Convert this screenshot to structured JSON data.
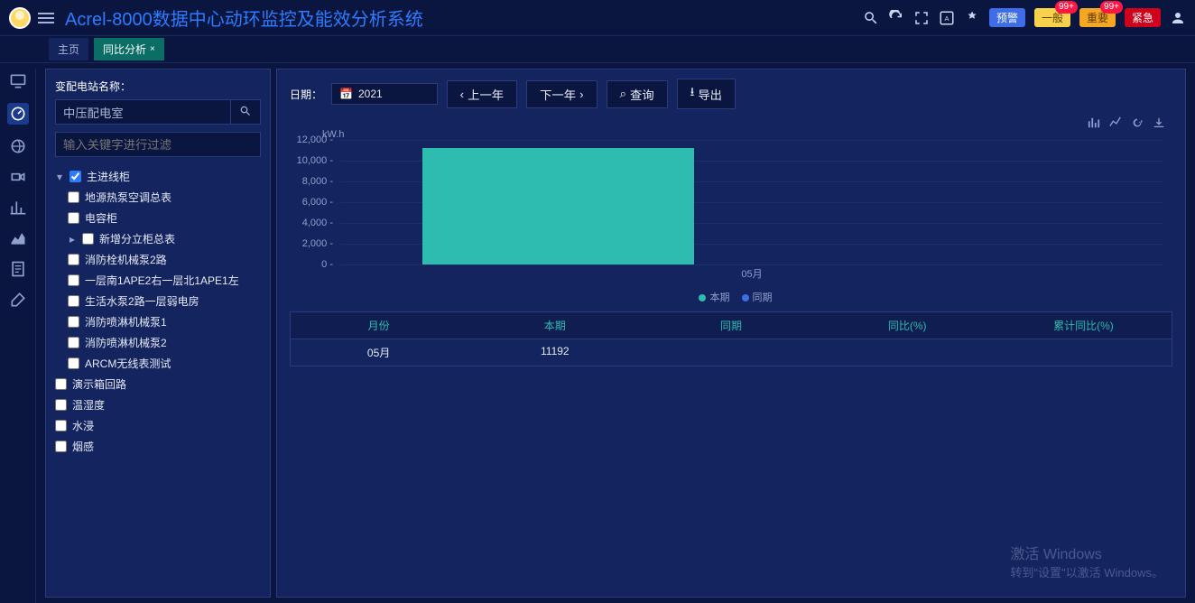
{
  "app_title": "Acrel-8000数据中心动环监控及能效分析系统",
  "tabs": {
    "home": "主页",
    "current": "同比分析"
  },
  "alerts": {
    "pre": "预警",
    "gen": "一般",
    "imp": "重要",
    "urg": "紧急",
    "badge": "99+"
  },
  "side": {
    "label": "变配电站名称：",
    "station": "中压配电室",
    "filter_ph": "输入关键字进行过滤",
    "tree": {
      "root": "主进线柜",
      "c1": "地源热泵空调总表",
      "c2": "电容柜",
      "c3": "新增分立柜总表",
      "c4": "消防栓机械泵2路",
      "c5": "一层南1APE2右一层北1APE1左",
      "c6": "生活水泵2路一层弱电房",
      "c7": "消防喷淋机械泵1",
      "c8": "消防喷淋机械泵2",
      "c9": "ARCM无线表测试",
      "r2": "演示箱回路",
      "r3": "温湿度",
      "r4": "水浸",
      "r5": "烟感"
    }
  },
  "query": {
    "label": "日期：",
    "year": "2021",
    "prev": "上一年",
    "next": "下一年",
    "search": "查询",
    "export": "导出"
  },
  "chart_data": {
    "type": "bar",
    "unit": "kW.h",
    "categories": [
      "05月"
    ],
    "series": [
      {
        "name": "本期",
        "values": [
          11192
        ]
      },
      {
        "name": "同期",
        "values": [
          null
        ]
      }
    ],
    "ylim": [
      0,
      12000
    ],
    "yticks": [
      0,
      2000,
      4000,
      6000,
      8000,
      10000,
      12000
    ],
    "xlabel": "05月"
  },
  "legend": {
    "a": "本期",
    "b": "同期"
  },
  "table": {
    "cols": {
      "m": "月份",
      "cur": "本期",
      "prev": "同期",
      "yoy": "同比(%)",
      "cum": "累计同比(%)"
    },
    "row": {
      "m": "05月",
      "cur": "11192",
      "prev": "",
      "yoy": "",
      "cum": ""
    }
  },
  "watermark": {
    "l1": "激活 Windows",
    "l2": "转到\"设置\"以激活 Windows。"
  }
}
